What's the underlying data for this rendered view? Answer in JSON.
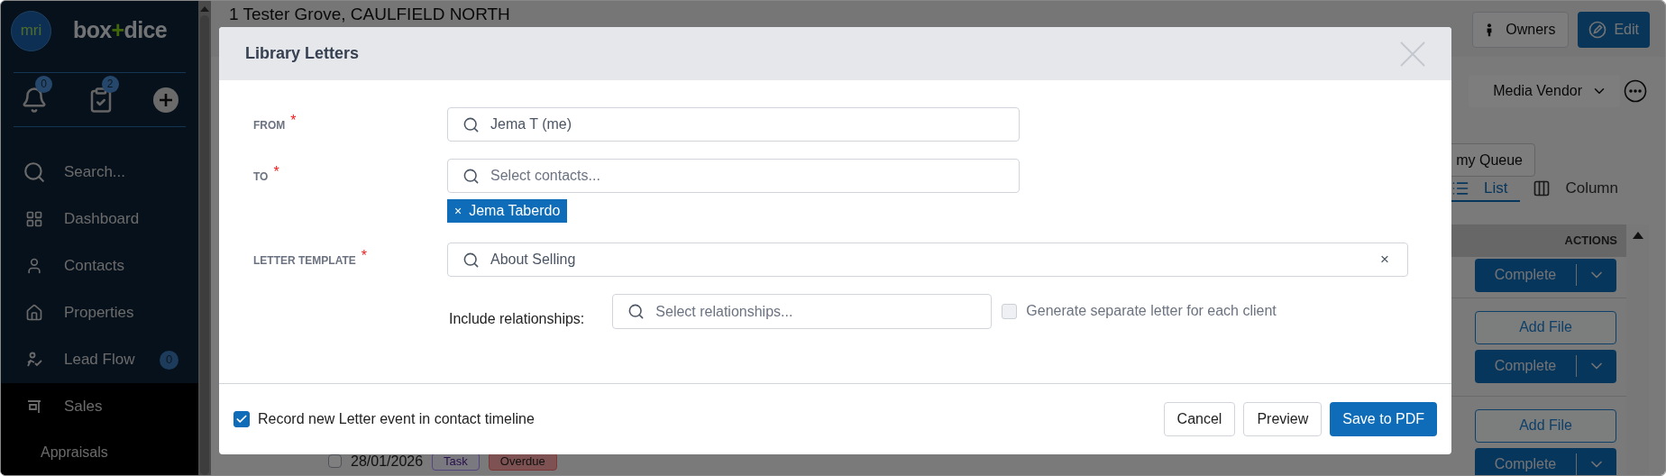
{
  "sidebar": {
    "logo": "mri",
    "brand": [
      {
        "text": "box",
        "accent": false
      },
      {
        "text": "+",
        "accent": true
      },
      {
        "text": "dice",
        "accent": false
      }
    ],
    "quick_actions": [
      {
        "kind": "bell",
        "badge": "0"
      },
      {
        "kind": "tasks",
        "badge": "2"
      },
      {
        "kind": "add"
      }
    ],
    "nav": [
      {
        "kind": "search",
        "label": "Search...",
        "selected": false
      },
      {
        "kind": "dashboard",
        "label": "Dashboard",
        "selected": false
      },
      {
        "kind": "contacts",
        "label": "Contacts",
        "selected": false
      },
      {
        "kind": "properties",
        "label": "Properties",
        "selected": false
      },
      {
        "kind": "leadflow",
        "label": "Lead Flow",
        "badge": "0",
        "selected": false
      },
      {
        "kind": "sales",
        "label": "Sales",
        "selected": true
      }
    ],
    "sub_items": [
      "Appraisals"
    ]
  },
  "header": {
    "title": "1 Tester Grove, CAULFIELD NORTH",
    "buttons": [
      {
        "kind": "secondary",
        "label": "Owners"
      },
      {
        "kind": "primary",
        "label": "Edit"
      }
    ]
  },
  "view_selector": {
    "value": "Media Vendor"
  },
  "queue_button": {
    "label": "my Queue"
  },
  "view_tabs": [
    {
      "kind": "list",
      "label": "List",
      "selected": true
    },
    {
      "kind": "column",
      "label": "Column",
      "selected": false
    }
  ],
  "table": {
    "columns": [
      "ACTIONS"
    ],
    "rows": [
      {
        "actions": [
          {
            "kind": "split",
            "label": "Complete"
          }
        ]
      },
      {
        "actions": [
          {
            "kind": "outline",
            "label": "Add File"
          },
          {
            "kind": "split",
            "label": "Complete"
          }
        ]
      },
      {
        "checked": false,
        "date": "28/01/2026",
        "tags": [
          {
            "label": "Task",
            "kind": "task"
          },
          {
            "label": "Overdue",
            "kind": "overdue"
          }
        ],
        "actions": [
          {
            "kind": "outline",
            "label": "Add File"
          },
          {
            "kind": "split",
            "label": "Complete"
          }
        ]
      }
    ]
  },
  "modal": {
    "title": "Library Letters",
    "fields": [
      {
        "label": "FROM",
        "required_mark": "*",
        "value": "Jema T (me)"
      },
      {
        "label": "TO",
        "required_mark": "*",
        "placeholder": "Select contacts...",
        "chips": [
          {
            "remove": "×",
            "label": "Jema Taberdo"
          }
        ]
      },
      {
        "label": "LETTER TEMPLATE",
        "required_mark": "*",
        "value": "About Selling",
        "clear": "×",
        "wide": true
      }
    ],
    "relationships": {
      "label": "Include relationships:",
      "placeholder": "Select relationships..."
    },
    "separate_letter": {
      "label": "Generate separate letter for each client",
      "checked": false
    },
    "record_event": {
      "label": "Record new Letter event in contact timeline",
      "checked": true
    },
    "buttons": [
      {
        "kind": "secondary",
        "label": "Cancel"
      },
      {
        "kind": "secondary",
        "label": "Preview"
      },
      {
        "kind": "primary",
        "label": "Save to PDF"
      }
    ]
  }
}
